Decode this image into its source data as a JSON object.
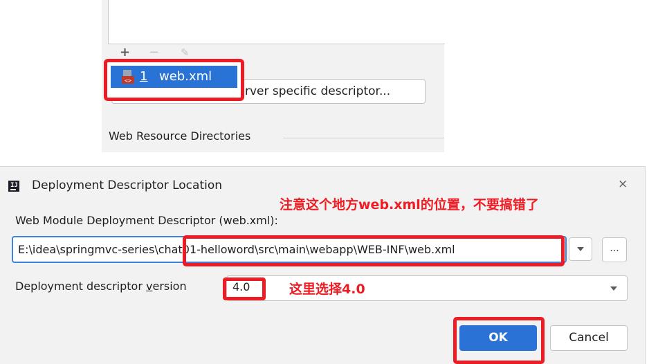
{
  "top_panel": {
    "toolbar": {
      "add_icon": "+",
      "remove_icon": "−",
      "edit_icon": "✎"
    },
    "add_button_label": "Add Application Server specific descriptor...",
    "popup": {
      "index": "1",
      "label": "web.xml",
      "icon": "xml-file-icon"
    },
    "section_label": "Web Resource Directories"
  },
  "dialog": {
    "title": "Deployment Descriptor Location",
    "close_icon": "×",
    "annotation_path": "注意这个地方web.xml的位置，不要搞错了",
    "field_label": "Web Module Deployment Descriptor (web.xml):",
    "path_value": "E:\\idea\\springmvc-series\\chat01-helloword\\src\\main\\webapp\\WEB-INF\\web.xml",
    "browse_label": "...",
    "version_label_pre": "Deployment descriptor ",
    "version_label_mnemonic": "v",
    "version_label_post": "ersion",
    "version_value": "4.0",
    "annotation_version": "这里选择4.0",
    "ok_label": "OK",
    "cancel_label": "Cancel"
  },
  "colors": {
    "highlight_red": "#ec1c24",
    "annotation_red": "#ee1d24",
    "accent_blue": "#2b72d7"
  }
}
